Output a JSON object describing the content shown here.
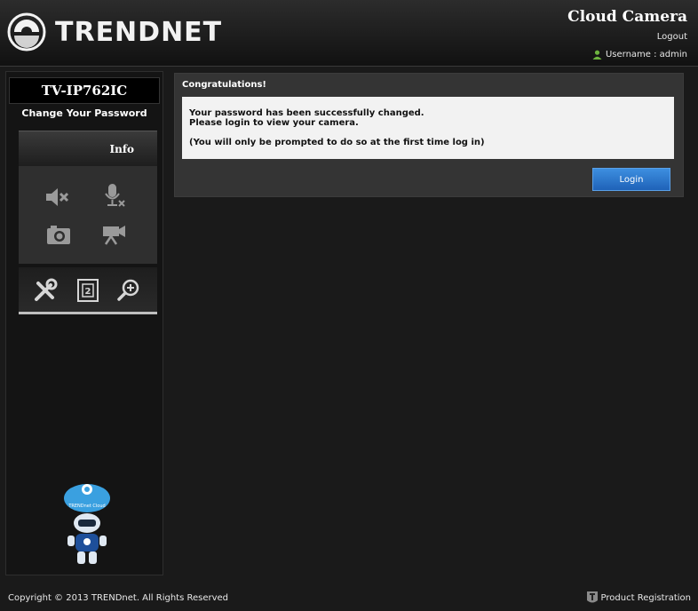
{
  "header": {
    "brand": "TRENDNET",
    "app_title": "Cloud Camera",
    "logout": "Logout",
    "username_line": "Username : admin"
  },
  "sidebar": {
    "model": "TV-IP762IC",
    "change_password": "Change Your Password",
    "info_tab": "Info",
    "controls": [
      "speaker-mute-icon",
      "microphone-mute-icon",
      "camera-snapshot-icon",
      "video-record-icon"
    ],
    "tools": [
      "settings-tools-icon",
      "film-frame-icon",
      "zoom-in-icon"
    ],
    "mascot_label": "TRENDnet Cloud"
  },
  "panel": {
    "title": "Congratulations!",
    "line1": "Your password has been successfully changed.",
    "line2": "Please login to view your camera.",
    "note": "(You will only be prompted to do so at the first time log in)",
    "login_button": "Login"
  },
  "footer": {
    "copyright": "Copyright © 2013 TRENDnet. All Rights Reserved",
    "registration": "Product Registration"
  },
  "colors": {
    "accent": "#2a76cc",
    "background": "#1a1a1a"
  }
}
